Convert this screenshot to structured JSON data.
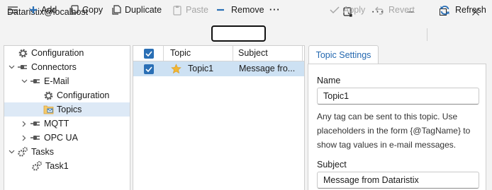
{
  "window": {
    "title": "Dataristix@localhost",
    "controls": {
      "extra_icon": "window-tools-icon",
      "more": "···",
      "minimize": "—",
      "maximize": "□",
      "close": "✕"
    }
  },
  "toolbar": {
    "add_label": "Add",
    "copy_label": "Copy",
    "duplicate_label": "Duplicate",
    "paste_label": "Paste",
    "remove_label": "Remove",
    "overflow_label": "···",
    "apply_label": "Apply",
    "revert_label": "Revert",
    "refresh_label": "Refresh"
  },
  "tree": {
    "items": [
      {
        "label": "Configuration",
        "icon": "gear-icon"
      },
      {
        "label": "Connectors",
        "icon": "plug-icon"
      },
      {
        "label": "E-Mail",
        "icon": "plug-icon"
      },
      {
        "label": "Configuration",
        "icon": "gear-icon"
      },
      {
        "label": "Topics",
        "icon": "topics-icon"
      },
      {
        "label": "MQTT",
        "icon": "plug-icon"
      },
      {
        "label": "OPC UA",
        "icon": "plug-icon"
      },
      {
        "label": "Tasks",
        "icon": "gears-icon"
      },
      {
        "label": "Task1",
        "icon": "gears-icon"
      }
    ]
  },
  "grid": {
    "columns": [
      "Topic",
      "Subject"
    ],
    "rows": [
      {
        "topic": "Topic1",
        "subject": "Message fro..."
      }
    ]
  },
  "settings": {
    "tab_label": "Topic Settings",
    "name_label": "Name",
    "name_value": "Topic1",
    "description": "Any tag can be sent to this topic. Use placeholders in the form {@TagName} to show tag values in e-mail messages.",
    "subject_label": "Subject",
    "subject_value": "Message from Dataristix"
  },
  "colors": {
    "accent": "#2a6fb5",
    "selection": "#cde1f3",
    "tree_selection": "#dde9f6",
    "star": "#f2b632"
  }
}
